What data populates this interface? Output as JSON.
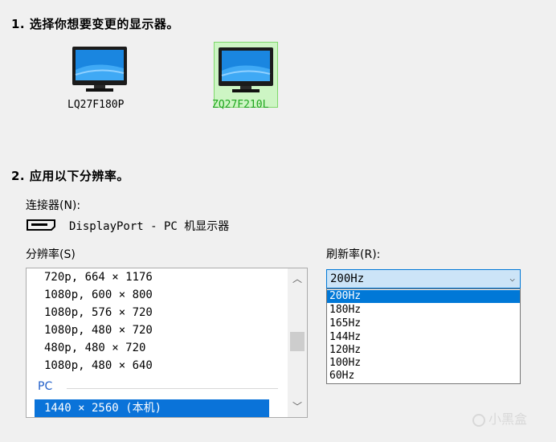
{
  "step1": {
    "title": "1. 选择你想要变更的显示器。"
  },
  "monitors": [
    {
      "label": "LQ27F180P",
      "selected": false
    },
    {
      "label": "ZQ27F210L",
      "selected": true
    }
  ],
  "step2": {
    "title": "2. 应用以下分辨率。"
  },
  "connector": {
    "label": "连接器(N):",
    "value": "DisplayPort - PC 机显示器",
    "icon": "displayport-icon"
  },
  "resolution": {
    "label": "分辨率(S)",
    "items": [
      "720p, 664 × 1176",
      "1080p, 600 × 800",
      "1080p, 576 × 720",
      "1080p, 480 × 720",
      "480p, 480 × 720",
      "1080p, 480 × 640"
    ],
    "group_label": "PC",
    "selected": "1440 × 2560 (本机)"
  },
  "refresh": {
    "label": "刷新率(R):",
    "selected": "200Hz",
    "options": [
      "200Hz",
      "180Hz",
      "165Hz",
      "144Hz",
      "120Hz",
      "100Hz",
      "60Hz"
    ]
  },
  "watermark": "小黑盒",
  "colors": {
    "selected_tile": "#cdf5c4",
    "selected_label": "#1fa51f",
    "list_highlight": "#0a73d9",
    "group_label": "#1f5ec9"
  }
}
